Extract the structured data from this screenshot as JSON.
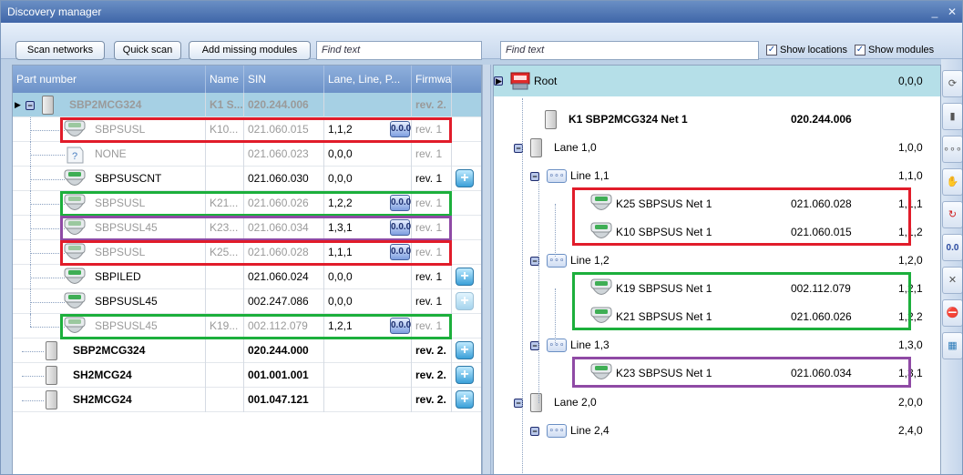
{
  "window": {
    "title": "Discovery manager",
    "min": "_",
    "close": "✕"
  },
  "toolbar": {
    "scan_networks": "Scan networks",
    "quick_scan": "Quick scan",
    "add_missing": "Add missing modules",
    "find_left_placeholder": "Find text",
    "find_right_placeholder": "Find text",
    "show_locations": "Show locations",
    "show_modules": "Show modules",
    "show_locations_checked": true,
    "show_modules_checked": true
  },
  "left_table": {
    "columns": [
      "Part number",
      "Name",
      "SIN",
      "Lane, Line, P...",
      "Firmwa"
    ],
    "rows": [
      {
        "part": "SBP2MCG324",
        "name": "K1 S...",
        "sin": "020.244.006",
        "lane": "",
        "fw": "rev. 2.",
        "style": "bold-grey",
        "selected": true,
        "icon": "master-unit-icon",
        "tree": "root",
        "badge": false,
        "plus": false
      },
      {
        "part": "SBPSUSL",
        "name": "K10...",
        "sin": "021.060.015",
        "lane": "1,1,2",
        "fw": "rev. 1",
        "style": "grey",
        "selected": false,
        "icon": "sensor-icon",
        "tree": "child",
        "badge": true,
        "plus": false
      },
      {
        "part": "NONE",
        "name": "",
        "sin": "021.060.023",
        "lane": "0,0,0",
        "fw": "rev. 1",
        "style": "grey",
        "selected": false,
        "icon": "unknown-device-icon",
        "tree": "child",
        "badge": false,
        "plus": false
      },
      {
        "part": "SBPSUSCNT",
        "name": "",
        "sin": "021.060.030",
        "lane": "0,0,0",
        "fw": "rev. 1",
        "style": "normal",
        "selected": false,
        "icon": "sensor-icon",
        "tree": "child",
        "badge": false,
        "plus": true
      },
      {
        "part": "SBPSUSL",
        "name": "K21...",
        "sin": "021.060.026",
        "lane": "1,2,2",
        "fw": "rev. 1",
        "style": "grey",
        "selected": false,
        "icon": "sensor-icon",
        "tree": "child",
        "badge": true,
        "plus": false
      },
      {
        "part": "SBPSUSL45",
        "name": "K23...",
        "sin": "021.060.034",
        "lane": "1,3,1",
        "fw": "rev. 1",
        "style": "grey",
        "selected": false,
        "icon": "sensor-icon",
        "tree": "child",
        "badge": true,
        "plus": false
      },
      {
        "part": "SBPSUSL",
        "name": "K25...",
        "sin": "021.060.028",
        "lane": "1,1,1",
        "fw": "rev. 1",
        "style": "grey",
        "selected": false,
        "icon": "sensor-icon",
        "tree": "child",
        "badge": true,
        "plus": false
      },
      {
        "part": "SBPILED",
        "name": "",
        "sin": "021.060.024",
        "lane": "0,0,0",
        "fw": "rev. 1",
        "style": "normal",
        "selected": false,
        "icon": "sensor-icon",
        "tree": "child",
        "badge": false,
        "plus": true
      },
      {
        "part": "SBPSUSL45",
        "name": "",
        "sin": "002.247.086",
        "lane": "0,0,0",
        "fw": "rev. 1",
        "style": "normal",
        "selected": false,
        "icon": "sensor-icon",
        "tree": "child",
        "badge": false,
        "plus": "dim"
      },
      {
        "part": "SBPSUSL45",
        "name": "K19...",
        "sin": "002.112.079",
        "lane": "1,2,1",
        "fw": "rev. 1",
        "style": "grey",
        "selected": false,
        "icon": "sensor-icon",
        "tree": "child-last",
        "badge": true,
        "plus": false
      },
      {
        "part": "SBP2MCG324",
        "name": "",
        "sin": "020.244.000",
        "lane": "",
        "fw": "rev. 2.",
        "style": "bold",
        "selected": false,
        "icon": "master-unit-icon",
        "tree": "top",
        "badge": false,
        "plus": true
      },
      {
        "part": "SH2MCG24",
        "name": "",
        "sin": "001.001.001",
        "lane": "",
        "fw": "rev. 2.",
        "style": "bold",
        "selected": false,
        "icon": "master-unit-icon",
        "tree": "top",
        "badge": false,
        "plus": true
      },
      {
        "part": "SH2MCG24",
        "name": "",
        "sin": "001.047.121",
        "lane": "",
        "fw": "rev. 2.",
        "style": "bold",
        "selected": false,
        "icon": "master-unit-icon",
        "tree": "top",
        "badge": false,
        "plus": true
      }
    ],
    "badge_text": "0.0.0"
  },
  "right_tree": {
    "rows": [
      {
        "label": "Root",
        "sin": "",
        "addr": "0,0,0",
        "kind": "root",
        "icon": "root-icon"
      },
      {
        "label": "K1 SBP2MCG324   Net 1",
        "sin": "020.244.006",
        "addr": "",
        "kind": "master",
        "icon": "master-unit-icon"
      },
      {
        "label": "Lane 1,0",
        "sin": "",
        "addr": "1,0,0",
        "kind": "lane",
        "icon": "lane-icon"
      },
      {
        "label": "Line 1,1",
        "sin": "",
        "addr": "1,1,0",
        "kind": "line",
        "icon": "line-icon"
      },
      {
        "label": "K25 SBPSUS Net 1",
        "sin": "021.060.028",
        "addr": "1,1,1",
        "kind": "sensor",
        "icon": "sensor-icon"
      },
      {
        "label": "K10 SBPSUS Net 1",
        "sin": "021.060.015",
        "addr": "1,1,2",
        "kind": "sensor",
        "icon": "sensor-icon"
      },
      {
        "label": "Line 1,2",
        "sin": "",
        "addr": "1,2,0",
        "kind": "line",
        "icon": "line-icon"
      },
      {
        "label": "K19 SBPSUS Net 1",
        "sin": "002.112.079",
        "addr": "1,2,1",
        "kind": "sensor",
        "icon": "sensor-icon"
      },
      {
        "label": "K21 SBPSUS Net 1",
        "sin": "021.060.026",
        "addr": "1,2,2",
        "kind": "sensor",
        "icon": "sensor-icon"
      },
      {
        "label": "Line 1,3",
        "sin": "",
        "addr": "1,3,0",
        "kind": "line",
        "icon": "line-icon"
      },
      {
        "label": "K23 SBPSUS Net 1",
        "sin": "021.060.034",
        "addr": "1,3,1",
        "kind": "sensor",
        "icon": "sensor-icon"
      },
      {
        "label": "Lane 2,0",
        "sin": "",
        "addr": "2,0,0",
        "kind": "lane",
        "icon": "lane-icon"
      },
      {
        "label": "Line 2,4",
        "sin": "",
        "addr": "2,4,0",
        "kind": "line",
        "icon": "line-icon"
      }
    ]
  },
  "side_toolbar": {
    "buttons": [
      "refresh-icon",
      "module-icon",
      "lines-icon",
      "hand-icon",
      "rotate-icon",
      "address-icon",
      "tools-icon",
      "stop-icon",
      "network-icon"
    ]
  },
  "colors": {
    "highlight_red": "#e11c2a",
    "highlight_green": "#1caf3c",
    "highlight_purple": "#8f4aa5",
    "selection": "#a6d0e4",
    "header": "#7a9dd0"
  }
}
